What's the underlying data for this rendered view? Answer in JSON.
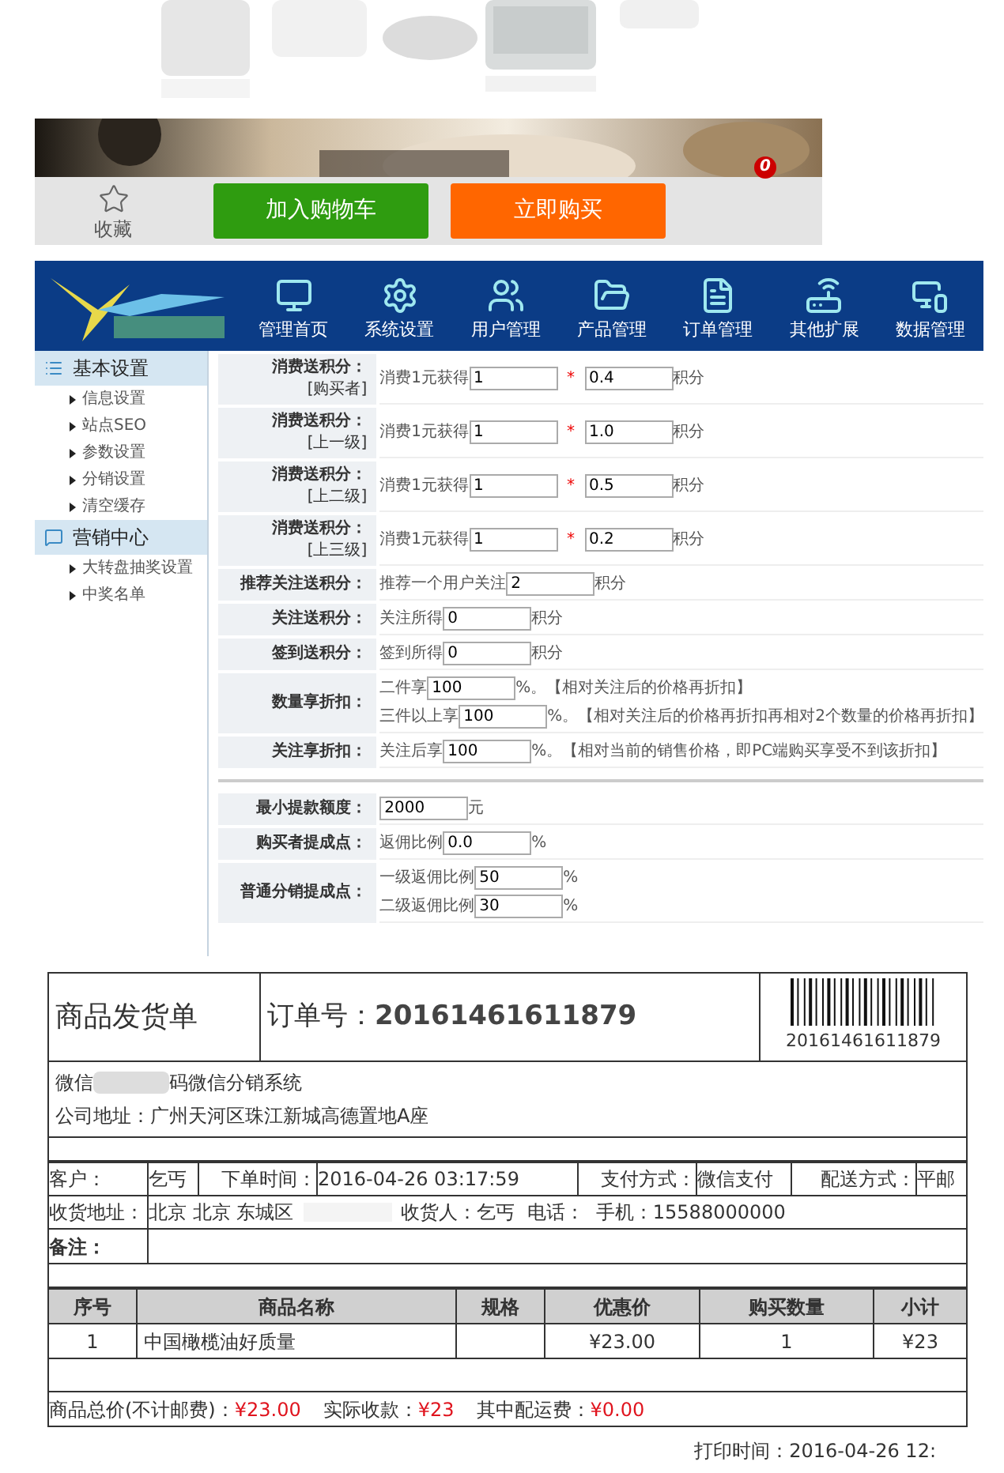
{
  "action_bar": {
    "favorite": "收藏",
    "cart_badge": "0",
    "buttons": [
      {
        "label": "加入购物车",
        "kind": "cart"
      },
      {
        "label": "立即购买",
        "kind": "buy"
      }
    ]
  },
  "admin": {
    "nav": [
      "管理首页",
      "系统设置",
      "用户管理",
      "产品管理",
      "订单管理",
      "其他扩展",
      "数据管理"
    ],
    "sidebar": [
      {
        "title": "基本设置",
        "items": [
          "信息设置",
          "站点SEO",
          "参数设置",
          "分销设置",
          "清空缓存"
        ]
      },
      {
        "title": "营销中心",
        "items": [
          "大转盘抽奖设置",
          "中奖名单"
        ]
      }
    ],
    "form_rows": [
      {
        "kind": "field",
        "label": "消费送积分：",
        "sublabel": "[购买者]",
        "lines": [
          [
            {
              "kind": "text",
              "text": "消费1元获得"
            },
            {
              "kind": "input",
              "value": "1"
            },
            {
              "kind": "required",
              "text": "*"
            },
            {
              "kind": "input",
              "value": "0.4"
            },
            {
              "kind": "text",
              "text": "积分"
            }
          ]
        ]
      },
      {
        "kind": "field",
        "label": "消费送积分：",
        "sublabel": "[上一级]",
        "lines": [
          [
            {
              "kind": "text",
              "text": "消费1元获得"
            },
            {
              "kind": "input",
              "value": "1"
            },
            {
              "kind": "required",
              "text": "*"
            },
            {
              "kind": "input",
              "value": "1.0"
            },
            {
              "kind": "text",
              "text": "积分"
            }
          ]
        ]
      },
      {
        "kind": "field",
        "label": "消费送积分：",
        "sublabel": "[上二级]",
        "lines": [
          [
            {
              "kind": "text",
              "text": "消费1元获得"
            },
            {
              "kind": "input",
              "value": "1"
            },
            {
              "kind": "required",
              "text": "*"
            },
            {
              "kind": "input",
              "value": "0.5"
            },
            {
              "kind": "text",
              "text": "积分"
            }
          ]
        ]
      },
      {
        "kind": "field",
        "label": "消费送积分：",
        "sublabel": "[上三级]",
        "lines": [
          [
            {
              "kind": "text",
              "text": "消费1元获得"
            },
            {
              "kind": "input",
              "value": "1"
            },
            {
              "kind": "required",
              "text": "*"
            },
            {
              "kind": "input",
              "value": "0.2"
            },
            {
              "kind": "text",
              "text": "积分"
            }
          ]
        ]
      },
      {
        "kind": "field",
        "label": "推荐关注送积分：",
        "lines": [
          [
            {
              "kind": "text",
              "text": "推荐一个用户关注"
            },
            {
              "kind": "input",
              "value": "2"
            },
            {
              "kind": "text",
              "text": "积分"
            }
          ]
        ]
      },
      {
        "kind": "field",
        "label": "关注送积分：",
        "lines": [
          [
            {
              "kind": "text",
              "text": "关注所得"
            },
            {
              "kind": "input",
              "value": "0"
            },
            {
              "kind": "text",
              "text": "积分"
            }
          ]
        ]
      },
      {
        "kind": "field",
        "label": "签到送积分：",
        "lines": [
          [
            {
              "kind": "text",
              "text": "签到所得"
            },
            {
              "kind": "input",
              "value": "0"
            },
            {
              "kind": "text",
              "text": "积分"
            }
          ]
        ]
      },
      {
        "kind": "field",
        "label": "数量享折扣：",
        "lines": [
          [
            {
              "kind": "text",
              "text": "二件享"
            },
            {
              "kind": "input",
              "value": "100"
            },
            {
              "kind": "text",
              "text": "%。【相对关注后的价格再折扣】"
            }
          ],
          [
            {
              "kind": "text",
              "text": "三件以上享"
            },
            {
              "kind": "input",
              "value": "100"
            },
            {
              "kind": "text",
              "text": "%。【相对关注后的价格再折扣再相对2个数量的价格再折扣】"
            }
          ]
        ]
      },
      {
        "kind": "field",
        "label": "关注享折扣：",
        "lines": [
          [
            {
              "kind": "text",
              "text": "关注后享"
            },
            {
              "kind": "input",
              "value": "100"
            },
            {
              "kind": "text",
              "text": "%。【相对当前的销售价格，即PC端购买享受不到该折扣】"
            }
          ]
        ]
      },
      {
        "kind": "separator"
      },
      {
        "kind": "field",
        "label": "最小提款额度：",
        "lines": [
          [
            {
              "kind": "input",
              "value": "2000"
            },
            {
              "kind": "text",
              "text": "元"
            }
          ]
        ]
      },
      {
        "kind": "field",
        "label": "购买者提成点：",
        "lines": [
          [
            {
              "kind": "text",
              "text": "返佣比例"
            },
            {
              "kind": "input",
              "value": "0.0"
            },
            {
              "kind": "text",
              "text": "%"
            }
          ]
        ]
      },
      {
        "kind": "field",
        "label": "普通分销提成点：",
        "lines": [
          [
            {
              "kind": "text",
              "text": "一级返佣比例"
            },
            {
              "kind": "input",
              "value": "50"
            },
            {
              "kind": "text",
              "text": "%"
            }
          ],
          [
            {
              "kind": "text",
              "text": "二级返佣比例"
            },
            {
              "kind": "input",
              "value": "30"
            },
            {
              "kind": "text",
              "text": "%"
            }
          ]
        ]
      }
    ]
  },
  "invoice": {
    "title": "商品发货单",
    "order_label": "订单号：",
    "order_number": "20161461611879",
    "barcode_number": "20161461611879",
    "company_parts": [
      "微信",
      "码微信分销系统"
    ],
    "address": "公司地址：广州天河区珠江新城高德置地A座",
    "customer_label": "客户：",
    "customer": "乞丐",
    "time_label": "下单时间：",
    "time": "2016-04-26 03:17:59",
    "pay_label": "支付方式：",
    "pay": "微信支付",
    "ship_label": "配送方式：",
    "ship": "平邮",
    "ship_address_label": "收货地址：",
    "ship_address": "北京 北京 东城区",
    "receiver": "收货人：乞丐  电话：  手机：15588000000",
    "remark_label": "备注：",
    "columns": [
      "序号",
      "商品名称",
      "规格",
      "优惠价",
      "购买数量",
      "小计"
    ],
    "rows": [
      {
        "no": "1",
        "name": "中国橄榄油好质量",
        "price": "¥23.00",
        "qty": "1",
        "subtotal": "¥23"
      }
    ],
    "totals": [
      {
        "label": "商品总价(不计邮费)：",
        "value": "¥23.00"
      },
      {
        "label": "实际收款：",
        "value": "¥23"
      },
      {
        "label": "其中配运费：",
        "value": "¥0.00"
      }
    ],
    "print_time": "打印时间：2016-04-26 12:"
  }
}
